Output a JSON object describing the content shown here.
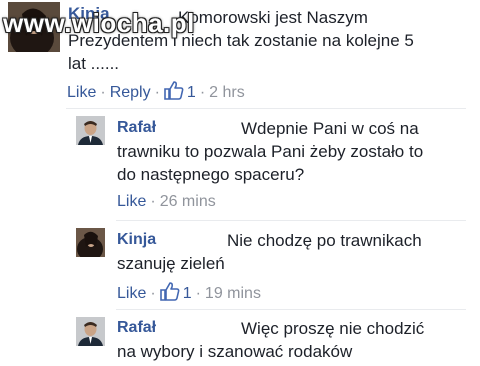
{
  "watermark": "www.wiocha.pl",
  "comments": [
    {
      "author": "Kinja",
      "text": "Komorowski jest Naszym\nPrezydentem i niech tak zostanie na kolejne 5\nlat ......",
      "like": "Like",
      "reply": "Reply",
      "like_count": "1",
      "time": "2 hrs"
    },
    {
      "author": "Rafał",
      "text": "Wdepnie Pani w coś na\ntrawniku to pozwala Pani żeby zostało to\ndo następnego spaceru?",
      "like": "Like",
      "time": "26 mins"
    },
    {
      "author": "Kinja",
      "text": "Nie chodzę po trawnikach\nszanuję zieleń",
      "like": "Like",
      "like_count": "1",
      "time": "19 mins"
    },
    {
      "author": "Rafał",
      "text": "Więc proszę nie chodzić\nna wybory i szanować rodaków"
    }
  ],
  "colors": {
    "link": "#365899",
    "meta": "#90949c",
    "text": "#1d2129"
  },
  "icons": {
    "like": "thumbs-up-icon"
  }
}
